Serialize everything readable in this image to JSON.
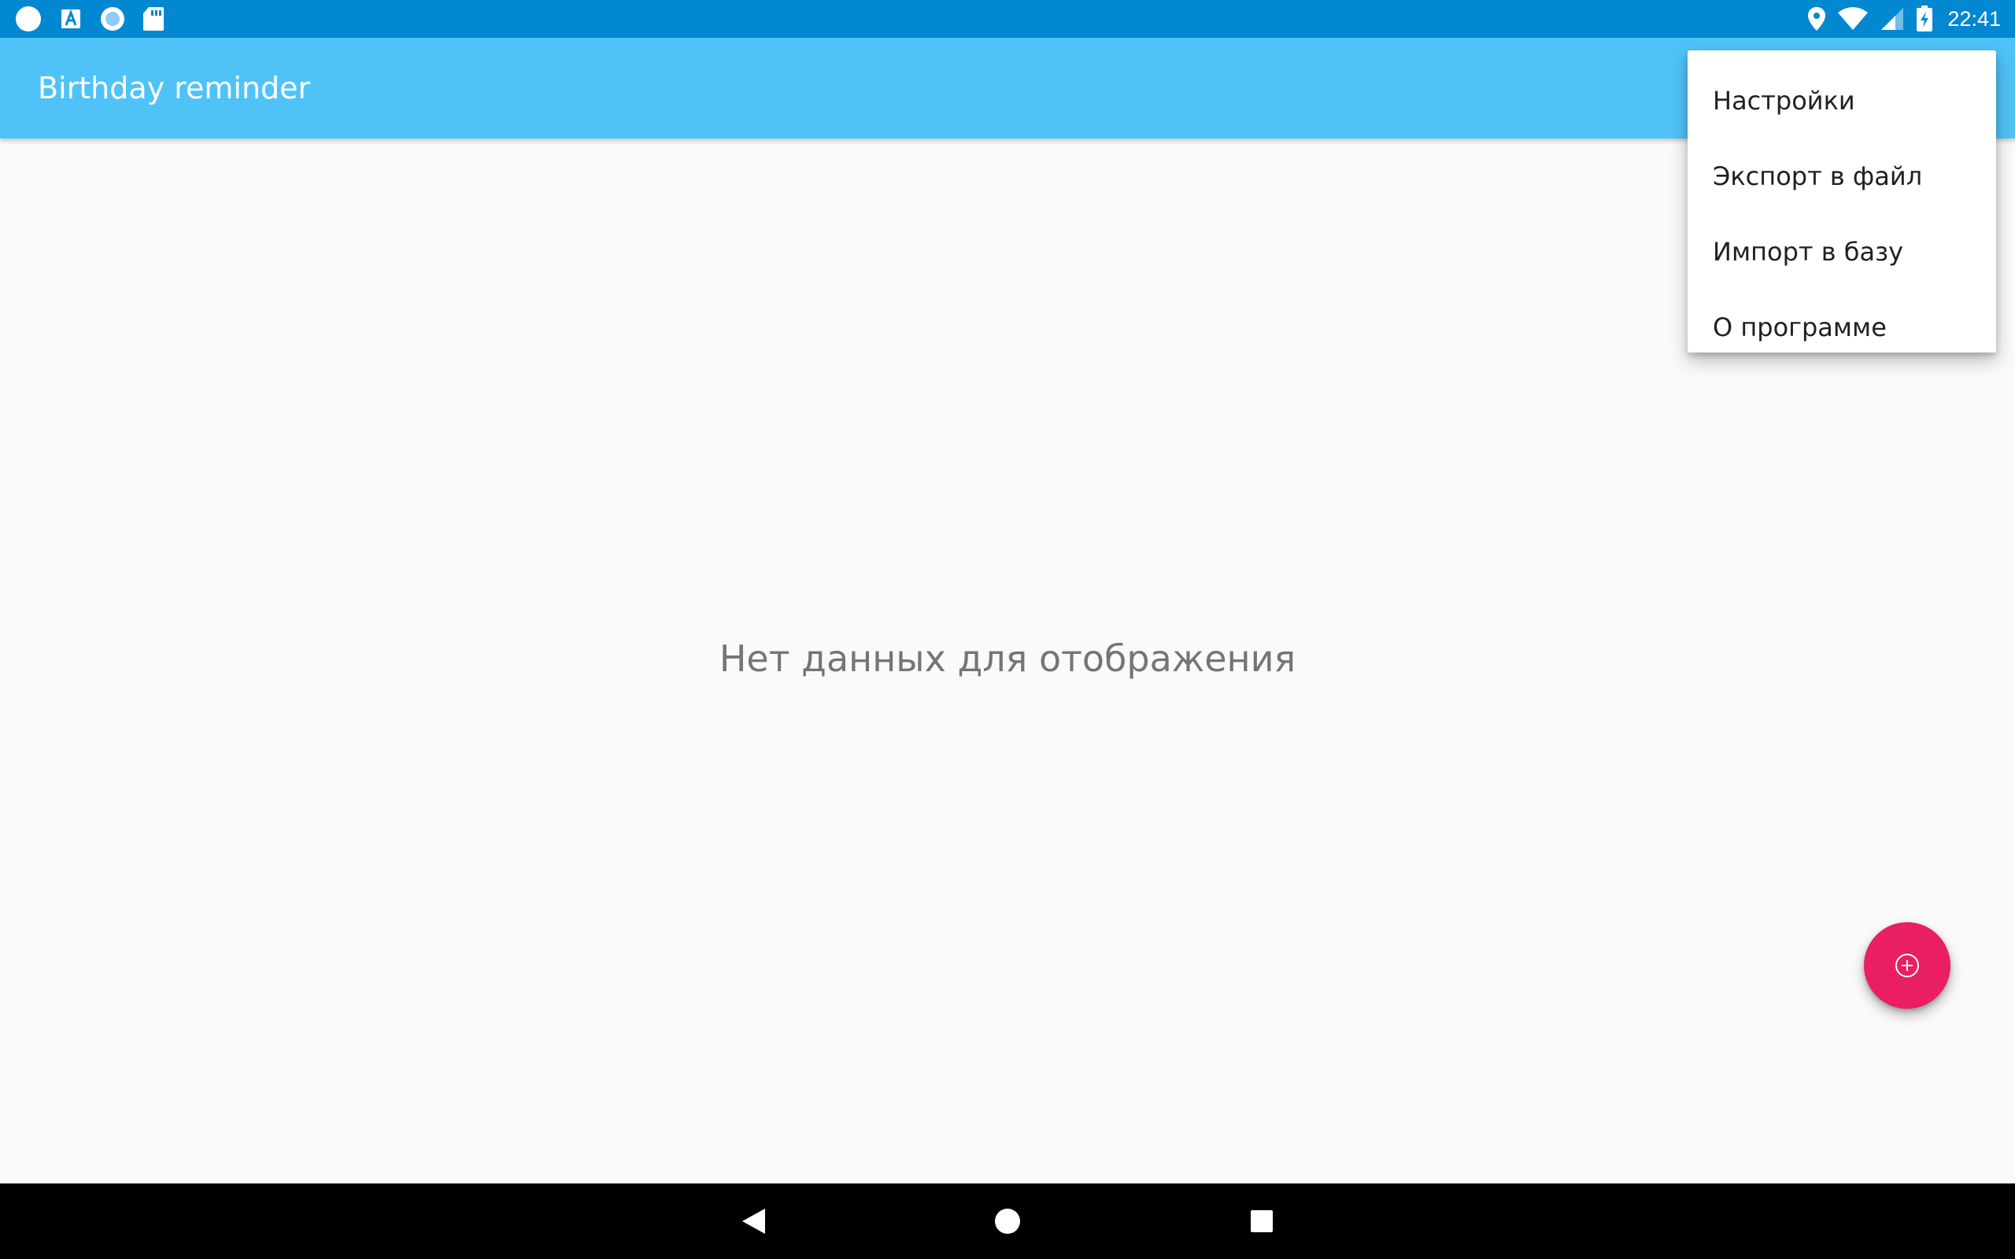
{
  "status_bar": {
    "left_icons": [
      "circle-notification-icon",
      "text-a-icon",
      "record-icon",
      "sd-card-icon"
    ],
    "right_icons": [
      "location-icon",
      "wifi-icon",
      "cell-signal-icon",
      "battery-charging-icon"
    ],
    "time": "22:41"
  },
  "app_bar": {
    "title": "Birthday reminder"
  },
  "main": {
    "empty_message": "Нет данных для отображения"
  },
  "fab": {
    "icon": "add-circle-icon"
  },
  "overflow_menu": {
    "items": [
      {
        "label": "Настройки"
      },
      {
        "label": "Экспорт в файл"
      },
      {
        "label": "Импорт в базу"
      },
      {
        "label": "О программе"
      }
    ]
  },
  "nav_bar": {
    "buttons": [
      "back-icon",
      "home-icon",
      "recents-icon"
    ]
  },
  "colors": {
    "status_bar": "#0288d1",
    "app_bar": "#4fc3f7",
    "fab": "#e91e63",
    "background": "#fafafa"
  }
}
